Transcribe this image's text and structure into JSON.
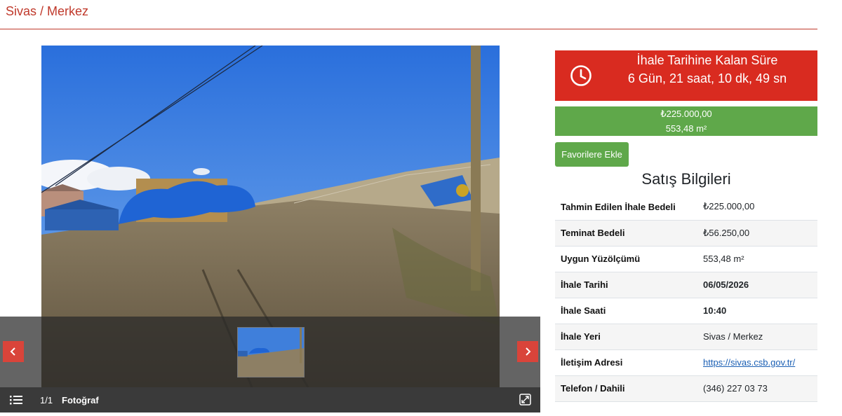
{
  "header": {
    "title": "Sivas / Merkez"
  },
  "gallery": {
    "counter": "1/1",
    "label": "Fotoğraf",
    "icons": {
      "prev": "chevron-left-icon",
      "next": "chevron-right-icon",
      "list": "list-icon",
      "expand": "expand-icon"
    }
  },
  "countdown": {
    "title": "İhale Tarihine Kalan Süre",
    "value": "6 Gün, 21 saat, 10 dk, 49 sn",
    "icon": "clock-icon"
  },
  "price_box": {
    "price": "₺225.000,00",
    "area": "553,48 m²"
  },
  "favorite_button": {
    "label": "Favorilere Ekle"
  },
  "sale_info": {
    "title": "Satış Bilgileri",
    "rows": [
      {
        "label": "Tahmin Edilen İhale Bedeli",
        "value": "₺225.000,00"
      },
      {
        "label": "Teminat Bedeli",
        "value": "₺56.250,00"
      },
      {
        "label": "Uygun Yüzölçümü",
        "value": "553,48 m²"
      },
      {
        "label": "İhale Tarihi",
        "value": "06/05/2026"
      },
      {
        "label": "İhale Saati",
        "value": "10:40"
      },
      {
        "label": "İhale Yeri",
        "value": "Sivas / Merkez"
      },
      {
        "label": "İletişim Adresi",
        "value": "https://sivas.csb.gov.tr/"
      },
      {
        "label": "Telefon / Dahili",
        "value": "(346) 227 03 73"
      }
    ]
  },
  "colors": {
    "accent": "#d92b20",
    "success": "#5fa84a",
    "title": "#c0392b",
    "link": "#1a5fb4"
  }
}
